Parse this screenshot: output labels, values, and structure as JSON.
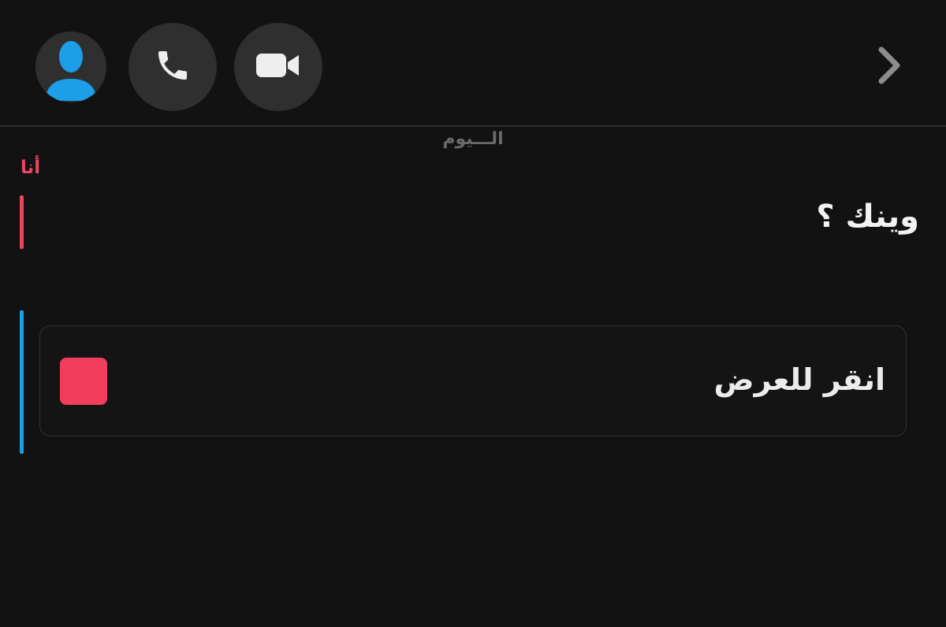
{
  "header": {
    "avatar_icon": "person-icon",
    "call_icon": "phone-icon",
    "video_icon": "video-camera-icon",
    "chevron_icon": "chevron-right-icon"
  },
  "chat": {
    "date_separator": "الـــيوم",
    "sender": "أنا",
    "message": "وينك ؟",
    "snap_label": "انقر للعرض"
  },
  "colors": {
    "background": "#121212",
    "sender_red": "#ea4562",
    "received_blue": "#1da1e6",
    "snap_red": "#f23e5c",
    "avatar_blue": "#1c9fe8"
  }
}
